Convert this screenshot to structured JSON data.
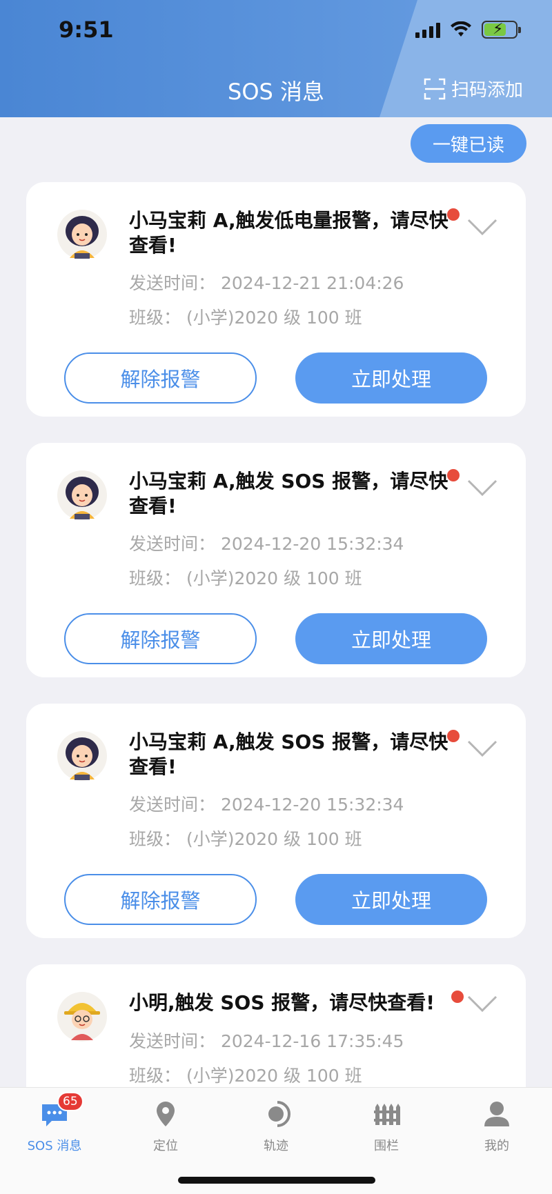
{
  "status_bar": {
    "time": "9:51"
  },
  "header": {
    "title": "SOS 消息",
    "scan_label": "扫码添加"
  },
  "mark_all_read": "一键已读",
  "messages": [
    {
      "title": "小马宝莉 A,触发低电量报警，请尽快查看!",
      "send_time": "发送时间：  2024-12-21 21:04:26",
      "class": "班级：  (小学)2020 级 100 班",
      "dismiss_label": "解除报警",
      "handle_label": "立即处理",
      "avatar": "girl-avatar-icon"
    },
    {
      "title": "小马宝莉 A,触发 SOS 报警，请尽快查看!",
      "send_time": "发送时间：  2024-12-20 15:32:34",
      "class": "班级：  (小学)2020 级 100 班",
      "dismiss_label": "解除报警",
      "handle_label": "立即处理",
      "avatar": "girl-avatar-icon"
    },
    {
      "title": "小马宝莉 A,触发 SOS 报警，请尽快查看!",
      "send_time": "发送时间：  2024-12-20 15:32:34",
      "class": "班级：  (小学)2020 级 100 班",
      "dismiss_label": "解除报警",
      "handle_label": "立即处理",
      "avatar": "girl-avatar-icon"
    },
    {
      "title": "小明,触发 SOS 报警，请尽快查看!",
      "send_time": "发送时间：  2024-12-16 17:35:45",
      "class": "班级：  (小学)2020 级 100 班",
      "avatar": "boy-avatar-icon"
    }
  ],
  "tabbar": {
    "items": [
      {
        "label": "SOS 消息",
        "icon": "chat-icon",
        "badge": "65",
        "active": true
      },
      {
        "label": "定位",
        "icon": "location-pin-icon"
      },
      {
        "label": "轨迹",
        "icon": "track-icon"
      },
      {
        "label": "围栏",
        "icon": "fence-icon"
      },
      {
        "label": "我的",
        "icon": "person-icon"
      }
    ]
  },
  "colors": {
    "primary": "#5a9bf0",
    "header": "#4a86d4",
    "unread": "#e74c3c",
    "badge": "#e53935"
  }
}
